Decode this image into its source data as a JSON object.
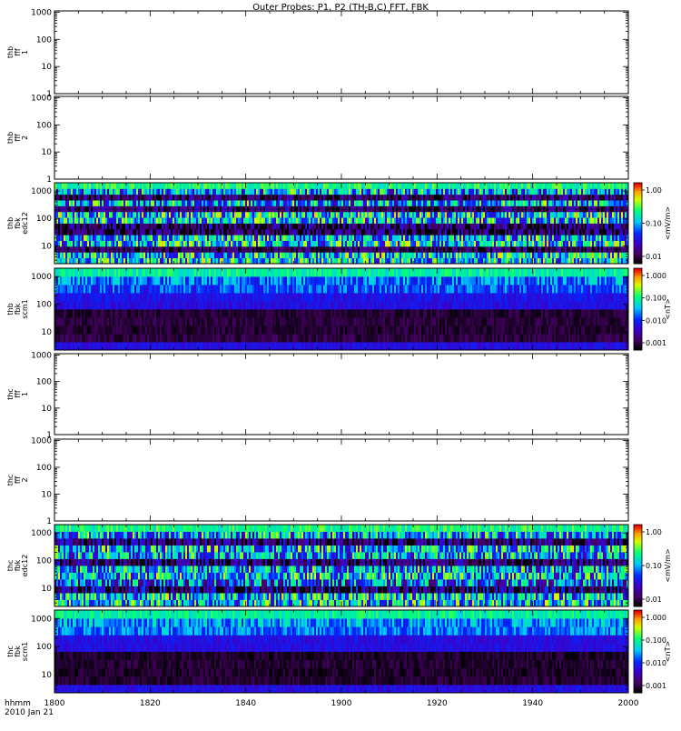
{
  "title": "Outer Probes: P1, P2 (TH-B,C) FFT, FBK",
  "time_axis": {
    "label": "hhmm",
    "date": "2010 Jan 21",
    "ticks": [
      "1800",
      "1820",
      "1840",
      "1900",
      "1920",
      "1940",
      "2000"
    ]
  },
  "chart_data": [
    {
      "type": "heatmap",
      "id": "thb-fff1",
      "ylabel": [
        "thb",
        "fff",
        "1"
      ],
      "yscale": "log",
      "yticks": [
        "1",
        "10",
        "100",
        "1000"
      ],
      "has_data": false
    },
    {
      "type": "heatmap",
      "id": "thb-fff2",
      "ylabel": [
        "thb",
        "fff",
        "2"
      ],
      "yscale": "log",
      "yticks": [
        "1",
        "10",
        "100",
        "1000"
      ],
      "has_data": false
    },
    {
      "type": "heatmap",
      "id": "thb-fbk-edc12",
      "ylabel": [
        "thb",
        "fbk",
        "edc12"
      ],
      "yscale": "log",
      "yticks": [
        "10",
        "100",
        "1000"
      ],
      "has_data": true,
      "bands": [
        {
          "level": 0.55,
          "var": 0.3
        },
        {
          "level": 0.55,
          "var": 0.3
        },
        {
          "level": 0.1,
          "var": 0.12
        },
        {
          "level": 0.55,
          "var": 0.3
        },
        {
          "level": 0.5,
          "var": 0.3
        },
        {
          "level": 0.1,
          "var": 0.2
        },
        {
          "level": 0.12,
          "var": 0.2
        },
        {
          "level": 0.52,
          "var": 0.3
        },
        {
          "level": 0.55,
          "var": 0.32
        },
        {
          "level": 0.13,
          "var": 0.15
        },
        {
          "level": 0.5,
          "var": 0.3
        },
        {
          "level": 0.12,
          "var": 0.15
        },
        {
          "level": 0.48,
          "var": 0.3
        },
        {
          "level": 0.65,
          "var": 0.1
        }
      ],
      "colorbar": {
        "label": "<mV/m>",
        "ticks": [
          "0.01",
          "0.10",
          "1.00"
        ]
      }
    },
    {
      "type": "heatmap",
      "id": "thb-fbk-scm1",
      "ylabel": [
        "thb",
        "fbk",
        "scm1"
      ],
      "yscale": "log",
      "yticks": [
        "10",
        "100",
        "1000"
      ],
      "has_data": true,
      "bands": [
        {
          "level": 0.3,
          "var": 0.04
        },
        {
          "level": 0.08,
          "var": 0.05
        },
        {
          "level": 0.06,
          "var": 0.05
        },
        {
          "level": 0.07,
          "var": 0.05
        },
        {
          "level": 0.06,
          "var": 0.05
        },
        {
          "level": 0.3,
          "var": 0.05
        },
        {
          "level": 0.32,
          "var": 0.06
        },
        {
          "level": 0.4,
          "var": 0.12
        },
        {
          "level": 0.45,
          "var": 0.16
        },
        {
          "level": 0.62,
          "var": 0.08
        }
      ],
      "colorbar": {
        "label": "<nT>",
        "ticks": [
          "0.001",
          "0.010",
          "0.100",
          "1.000"
        ]
      }
    },
    {
      "type": "heatmap",
      "id": "thc-fff1",
      "ylabel": [
        "thc",
        "fff",
        "1"
      ],
      "yscale": "log",
      "yticks": [
        "1",
        "10",
        "100",
        "1000"
      ],
      "has_data": false
    },
    {
      "type": "heatmap",
      "id": "thc-fff2",
      "ylabel": [
        "thc",
        "fff",
        "2"
      ],
      "yscale": "log",
      "yticks": [
        "1",
        "10",
        "100",
        "1000"
      ],
      "has_data": false
    },
    {
      "type": "heatmap",
      "id": "thc-fbk-edc12",
      "ylabel": [
        "thc",
        "fbk",
        "edc12"
      ],
      "yscale": "log",
      "yticks": [
        "10",
        "100",
        "1000"
      ],
      "has_data": true,
      "bands": [
        {
          "level": 0.55,
          "var": 0.3
        },
        {
          "level": 0.55,
          "var": 0.3
        },
        {
          "level": 0.12,
          "var": 0.3
        },
        {
          "level": 0.4,
          "var": 0.3
        },
        {
          "level": 0.52,
          "var": 0.3
        },
        {
          "level": 0.48,
          "var": 0.3
        },
        {
          "level": 0.14,
          "var": 0.2
        },
        {
          "level": 0.48,
          "var": 0.3
        },
        {
          "level": 0.52,
          "var": 0.3
        },
        {
          "level": 0.14,
          "var": 0.2
        },
        {
          "level": 0.5,
          "var": 0.3
        },
        {
          "level": 0.65,
          "var": 0.1
        }
      ],
      "colorbar": {
        "label": "<mV/m>",
        "ticks": [
          "0.01",
          "0.10",
          "1.00"
        ]
      }
    },
    {
      "type": "heatmap",
      "id": "thc-fbk-scm1",
      "ylabel": [
        "thc",
        "fbk",
        "scm1"
      ],
      "yscale": "log",
      "yticks": [
        "10",
        "100",
        "1000"
      ],
      "has_data": true,
      "bands": [
        {
          "level": 0.3,
          "var": 0.04
        },
        {
          "level": 0.06,
          "var": 0.05
        },
        {
          "level": 0.05,
          "var": 0.05
        },
        {
          "level": 0.06,
          "var": 0.05
        },
        {
          "level": 0.05,
          "var": 0.05
        },
        {
          "level": 0.3,
          "var": 0.04
        },
        {
          "level": 0.3,
          "var": 0.05
        },
        {
          "level": 0.45,
          "var": 0.12
        },
        {
          "level": 0.48,
          "var": 0.15
        },
        {
          "level": 0.62,
          "var": 0.08
        }
      ],
      "colorbar": {
        "label": "<nT>",
        "ticks": [
          "0.001",
          "0.010",
          "0.100",
          "1.000"
        ]
      }
    }
  ]
}
